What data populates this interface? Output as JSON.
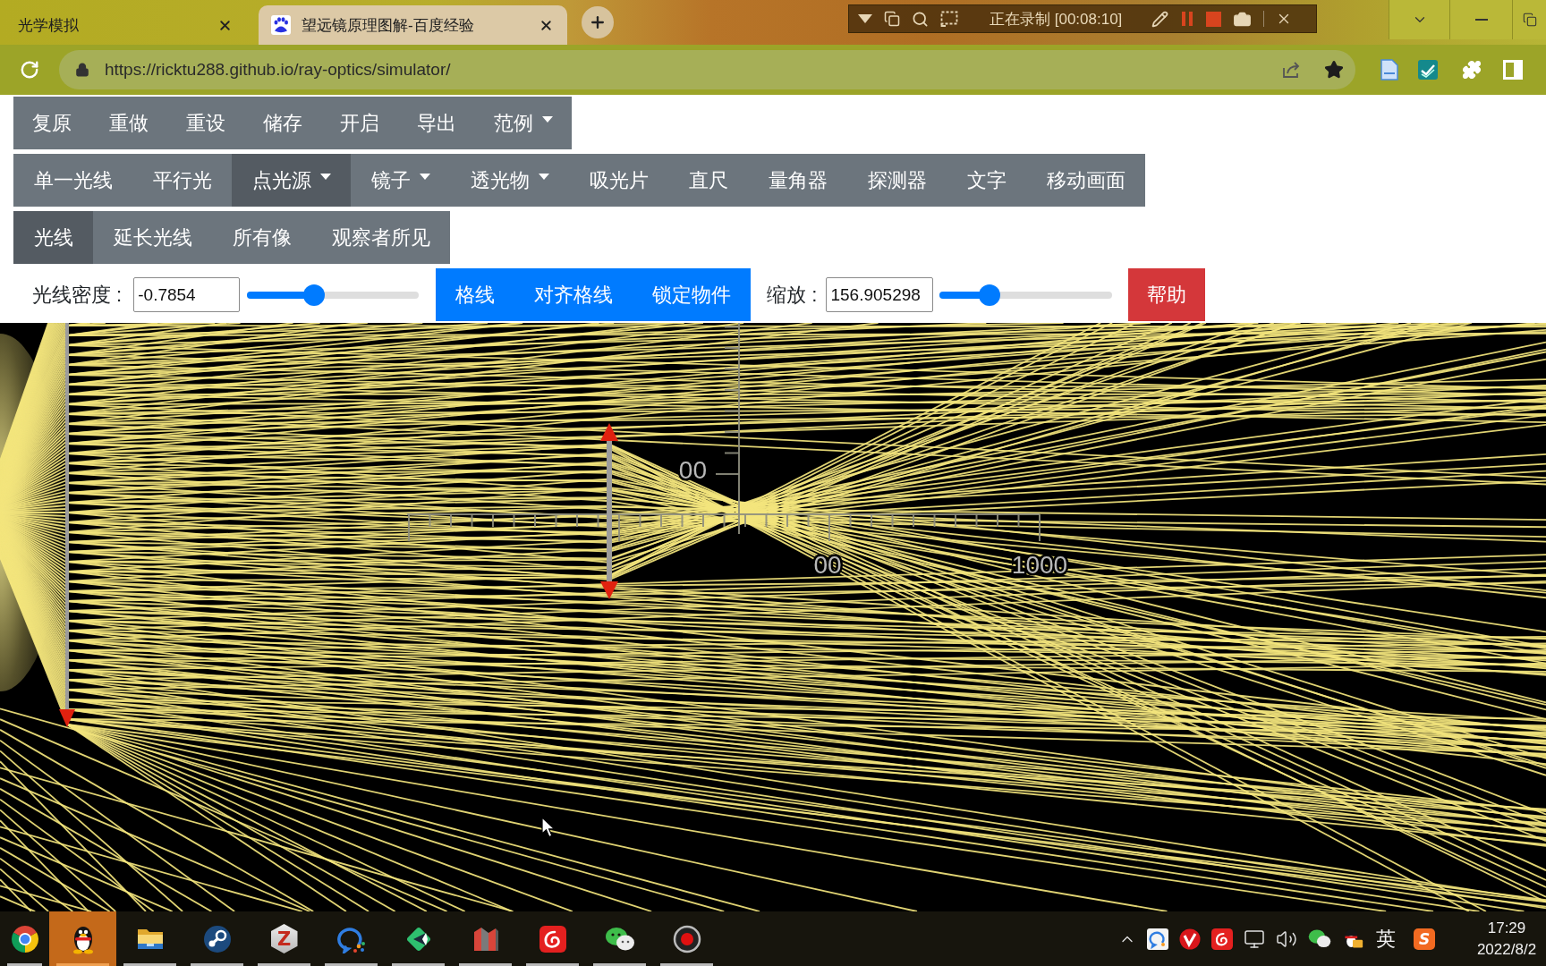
{
  "browser": {
    "tabs": [
      {
        "title": "光学模拟",
        "selected": false
      },
      {
        "title": "望远镜原理图解-百度经验",
        "selected": true
      }
    ],
    "url": "https://ricktu288.github.io/ray-optics/simulator/"
  },
  "recorder": {
    "status": "正在录制 [00:08:10]"
  },
  "file_menu": [
    {
      "label": "复原",
      "dropdown": false
    },
    {
      "label": "重做",
      "dropdown": false
    },
    {
      "label": "重设",
      "dropdown": false
    },
    {
      "label": "储存",
      "dropdown": false
    },
    {
      "label": "开启",
      "dropdown": false
    },
    {
      "label": "导出",
      "dropdown": false
    },
    {
      "label": "范例",
      "dropdown": true
    }
  ],
  "tools": [
    {
      "label": "单一光线",
      "selected": false,
      "dropdown": false
    },
    {
      "label": "平行光",
      "selected": false,
      "dropdown": false
    },
    {
      "label": "点光源",
      "selected": true,
      "dropdown": true
    },
    {
      "label": "镜子",
      "selected": false,
      "dropdown": true
    },
    {
      "label": "透光物",
      "selected": false,
      "dropdown": true
    },
    {
      "label": "吸光片",
      "selected": false,
      "dropdown": false
    },
    {
      "label": "直尺",
      "selected": false,
      "dropdown": false
    },
    {
      "label": "量角器",
      "selected": false,
      "dropdown": false
    },
    {
      "label": "探测器",
      "selected": false,
      "dropdown": false
    },
    {
      "label": "文字",
      "selected": false,
      "dropdown": false
    },
    {
      "label": "移动画面",
      "selected": false,
      "dropdown": false
    }
  ],
  "view_modes": [
    {
      "label": "光线",
      "selected": true
    },
    {
      "label": "延长光线",
      "selected": false
    },
    {
      "label": "所有像",
      "selected": false
    },
    {
      "label": "观察者所见",
      "selected": false
    }
  ],
  "controls": {
    "ray_density": {
      "label": "光线密度 :",
      "value": "-0.7854",
      "level": 0.39
    },
    "toggles": [
      {
        "label": "格线"
      },
      {
        "label": "对齐格线"
      },
      {
        "label": "锁定物件"
      }
    ],
    "zoom": {
      "label": "缩放 :",
      "value": "156.905298",
      "level": 0.29
    },
    "help": {
      "label": "帮助"
    }
  },
  "canvas": {
    "ruler_labels": [
      "00",
      "00",
      "1000"
    ]
  },
  "taskbar": {
    "apps": [
      {
        "kind": "browser",
        "selected": false,
        "running": true
      },
      {
        "kind": "penguin",
        "selected": true,
        "running": true
      },
      {
        "kind": "folder",
        "selected": false,
        "running": true
      },
      {
        "kind": "steam",
        "selected": false,
        "running": true
      },
      {
        "kind": "letter",
        "glyph": "Z",
        "selected": false,
        "running": true
      },
      {
        "kind": "meeting",
        "selected": false,
        "running": true
      },
      {
        "kind": "arrow",
        "selected": false,
        "running": true
      },
      {
        "kind": "bars",
        "selected": false,
        "running": true
      },
      {
        "kind": "music",
        "selected": false,
        "running": true
      },
      {
        "kind": "chat",
        "selected": false,
        "running": true
      },
      {
        "kind": "record",
        "selected": false,
        "running": true
      }
    ],
    "tray": {
      "ime": "英",
      "ime_logo": "S",
      "time": "17:29",
      "date": "2022/8/2"
    }
  }
}
